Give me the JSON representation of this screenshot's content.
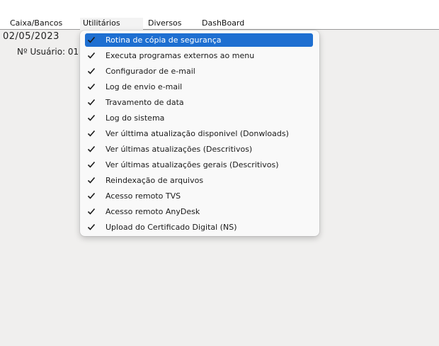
{
  "menubar": {
    "items": [
      {
        "label": "Caixa/Bancos"
      },
      {
        "label": "Utilitários"
      },
      {
        "label": "Diversos"
      },
      {
        "label": "DashBoard"
      }
    ]
  },
  "status": {
    "date": "02/05/2023",
    "user": "Nº Usuário: 01"
  },
  "dropdown": {
    "items": [
      {
        "label": "Rotina de cópia de segurança",
        "checked": true,
        "selected": true
      },
      {
        "label": "Executa programas externos ao menu",
        "checked": true
      },
      {
        "label": "Configurador de e-mail",
        "checked": true
      },
      {
        "label": "Log de envio e-mail",
        "checked": true
      },
      {
        "label": "Travamento de data",
        "checked": true
      },
      {
        "label": "Log do sistema",
        "checked": true
      },
      {
        "label": "Ver últtima atualização disponivel (Donwloads)",
        "checked": true
      },
      {
        "label": "Ver últimas atualizações (Descritivos)",
        "checked": true
      },
      {
        "label": "Ver últimas atualizações gerais (Descritivos)",
        "checked": true
      },
      {
        "label": "Reindexação de arquivos",
        "checked": true
      },
      {
        "label": "Acesso remoto TVS",
        "checked": true
      },
      {
        "label": "Acesso remoto AnyDesk",
        "checked": true
      },
      {
        "label": "Upload do Certificado Digital (NS)",
        "checked": true
      }
    ]
  },
  "icons": {
    "item_check": "checkmark-icon"
  },
  "colors": {
    "selection": "#1e6fd1",
    "menu_background": "#f9f9f9",
    "desktop": "#f0efee"
  }
}
